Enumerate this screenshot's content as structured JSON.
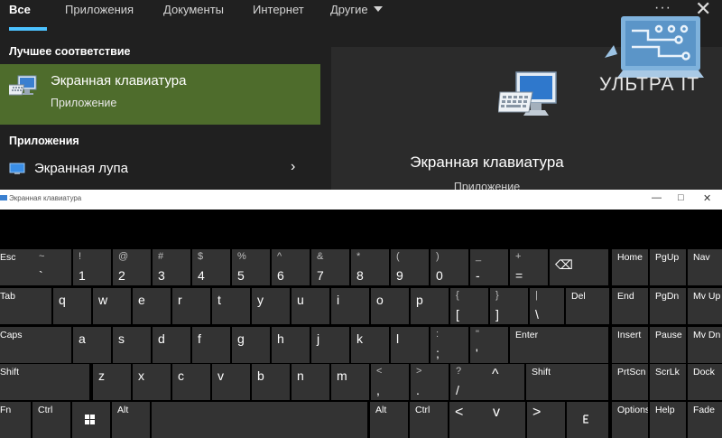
{
  "search": {
    "tabs": [
      "Все",
      "Приложения",
      "Документы",
      "Интернет",
      "Другие"
    ],
    "more": "···",
    "close": "✕",
    "best_match_title": "Лучшее соответствие",
    "best_match": {
      "title": "Экранная клавиатура",
      "type": "Приложение",
      "icon": "keyboard-monitor-icon"
    },
    "apps_title": "Приложения",
    "apps": [
      {
        "label": "Экранная лупа",
        "icon": "magnifier-icon"
      }
    ],
    "preview": {
      "title": "Экранная клавиатура",
      "type": "Приложение",
      "icon": "keyboard-monitor-icon"
    }
  },
  "watermark": {
    "text": "УЛЬТРА IT"
  },
  "osk": {
    "title": "Экранная клавиатура",
    "window_buttons": [
      "—",
      "□",
      "✕"
    ]
  },
  "keyboard": {
    "rows": [
      [
        {
          "main": "Esc"
        },
        {
          "main": "`",
          "shift": "~"
        },
        {
          "main": "1",
          "shift": "!"
        },
        {
          "main": "2",
          "shift": "@"
        },
        {
          "main": "3",
          "shift": "#"
        },
        {
          "main": "4",
          "shift": "$"
        },
        {
          "main": "5",
          "shift": "%"
        },
        {
          "main": "6",
          "shift": "^"
        },
        {
          "main": "7",
          "shift": "&"
        },
        {
          "main": "8",
          "shift": "*"
        },
        {
          "main": "9",
          "shift": "("
        },
        {
          "main": "0",
          "shift": ")"
        },
        {
          "main": "-",
          "shift": "_"
        },
        {
          "main": "=",
          "shift": "+"
        },
        {
          "main": "⌫"
        },
        {
          "main": "Home"
        },
        {
          "main": "PgUp"
        },
        {
          "main": "Nav"
        }
      ],
      [
        {
          "main": "Tab"
        },
        {
          "main": "q"
        },
        {
          "main": "w"
        },
        {
          "main": "e"
        },
        {
          "main": "r"
        },
        {
          "main": "t"
        },
        {
          "main": "y"
        },
        {
          "main": "u"
        },
        {
          "main": "i"
        },
        {
          "main": "o"
        },
        {
          "main": "p"
        },
        {
          "main": "[",
          "shift": "{"
        },
        {
          "main": "]",
          "shift": "}"
        },
        {
          "main": "\\",
          "shift": "|"
        },
        {
          "main": "Del"
        },
        {
          "main": "End"
        },
        {
          "main": "PgDn"
        },
        {
          "main": "Mv Up"
        }
      ],
      [
        {
          "main": "Caps"
        },
        {
          "main": "a"
        },
        {
          "main": "s"
        },
        {
          "main": "d"
        },
        {
          "main": "f"
        },
        {
          "main": "g"
        },
        {
          "main": "h"
        },
        {
          "main": "j"
        },
        {
          "main": "k"
        },
        {
          "main": "l"
        },
        {
          "main": ";",
          "shift": ":"
        },
        {
          "main": "'",
          "shift": "\""
        },
        {
          "main": "Enter"
        },
        {
          "main": "Insert"
        },
        {
          "main": "Pause"
        },
        {
          "main": "Mv Dn"
        }
      ],
      [
        {
          "main": "Shift"
        },
        {
          "main": "z"
        },
        {
          "main": "x"
        },
        {
          "main": "c"
        },
        {
          "main": "v"
        },
        {
          "main": "b"
        },
        {
          "main": "n"
        },
        {
          "main": "m"
        },
        {
          "main": ",",
          "shift": "<"
        },
        {
          "main": ".",
          "shift": ">"
        },
        {
          "main": "/",
          "shift": "?"
        },
        {
          "main": "^"
        },
        {
          "main": "Shift"
        },
        {
          "main": "PrtScn"
        },
        {
          "main": "ScrLk"
        },
        {
          "main": "Dock"
        }
      ],
      [
        {
          "main": "Fn"
        },
        {
          "main": "Ctrl"
        },
        {
          "main": "windows-icon"
        },
        {
          "main": "Alt"
        },
        {
          "main": ""
        },
        {
          "main": "Alt"
        },
        {
          "main": "Ctrl"
        },
        {
          "main": "<"
        },
        {
          "main": "v"
        },
        {
          "main": ">"
        },
        {
          "main": "keyboard-layout-icon"
        },
        {
          "main": "Options"
        },
        {
          "main": "Help"
        },
        {
          "main": "Fade"
        }
      ]
    ]
  },
  "colors": {
    "panel": "#202020",
    "highlight": "#4e6c2c",
    "accent": "#4cc2ff",
    "key": "#333333",
    "keyboard_bg": "#000000"
  }
}
